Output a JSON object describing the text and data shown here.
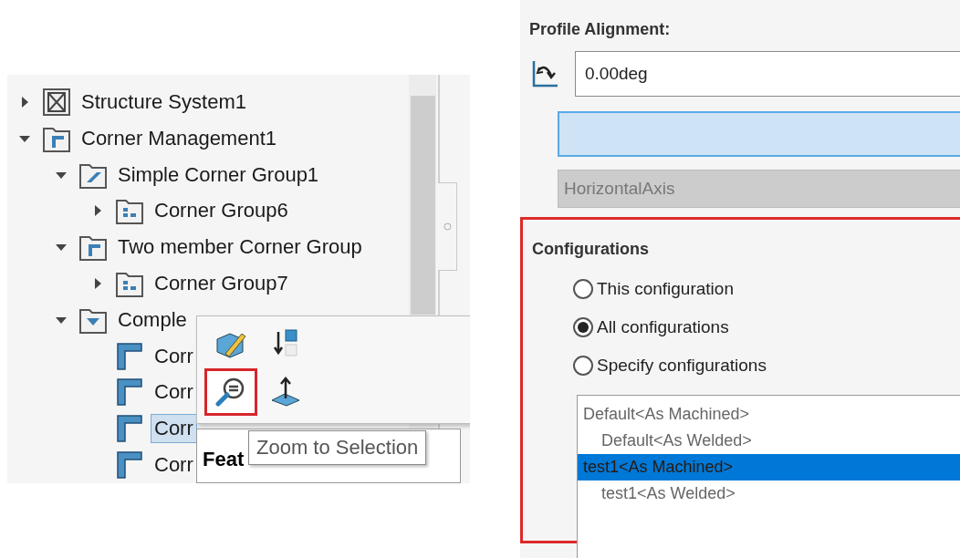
{
  "tree": [
    {
      "label": "Structure System1",
      "kind": "structure",
      "expanded": false,
      "selected": false
    },
    {
      "label": "Corner Management1",
      "kind": "management",
      "expanded": true,
      "selected": false,
      "children": [
        {
          "label": "Simple Corner Group1",
          "kind": "simple",
          "expanded": true,
          "selected": false,
          "children": [
            {
              "label": "Corner Group6",
              "kind": "group",
              "expanded": false,
              "selected": false
            }
          ]
        },
        {
          "label": "Two member Corner Group",
          "kind": "management",
          "expanded": true,
          "selected": false,
          "children": [
            {
              "label": "Corner Group7",
              "kind": "group",
              "expanded": false,
              "selected": false
            }
          ]
        },
        {
          "label": "Comple",
          "kind": "complex",
          "expanded": true,
          "selected": false,
          "children": [
            {
              "label": "Corr",
              "kind": "corner",
              "selected": false
            },
            {
              "label": "Corr",
              "kind": "corner",
              "selected": false
            },
            {
              "label": "Corr",
              "kind": "corner",
              "selected": true
            },
            {
              "label": "Corr",
              "kind": "corner",
              "selected": false
            }
          ]
        }
      ]
    }
  ],
  "popup": {
    "buttons": [
      {
        "kind": "edit",
        "selected": false
      },
      {
        "kind": "rollback",
        "selected": false
      },
      {
        "kind": "zoom",
        "selected": true
      },
      {
        "kind": "normal",
        "selected": false
      }
    ]
  },
  "feature_tooltip": "Feat",
  "tooltip": "Zoom to Selection",
  "profile_alignment": {
    "label": "Profile Alignment:",
    "angle": "0.00deg",
    "axis": "HorizontalAxis"
  },
  "configurations": {
    "label": "Configurations",
    "options": [
      {
        "label": "This configuration",
        "selected": false
      },
      {
        "label": "All configurations",
        "selected": true
      },
      {
        "label": "Specify configurations",
        "selected": false
      }
    ],
    "list": [
      {
        "label": "Default<As Machined>",
        "selected": false,
        "children": [
          {
            "label": "Default<As Welded>",
            "selected": false
          }
        ]
      },
      {
        "label": "test1<As Machined>",
        "selected": true,
        "children": [
          {
            "label": "test1<As Welded>",
            "selected": false
          }
        ]
      }
    ]
  }
}
